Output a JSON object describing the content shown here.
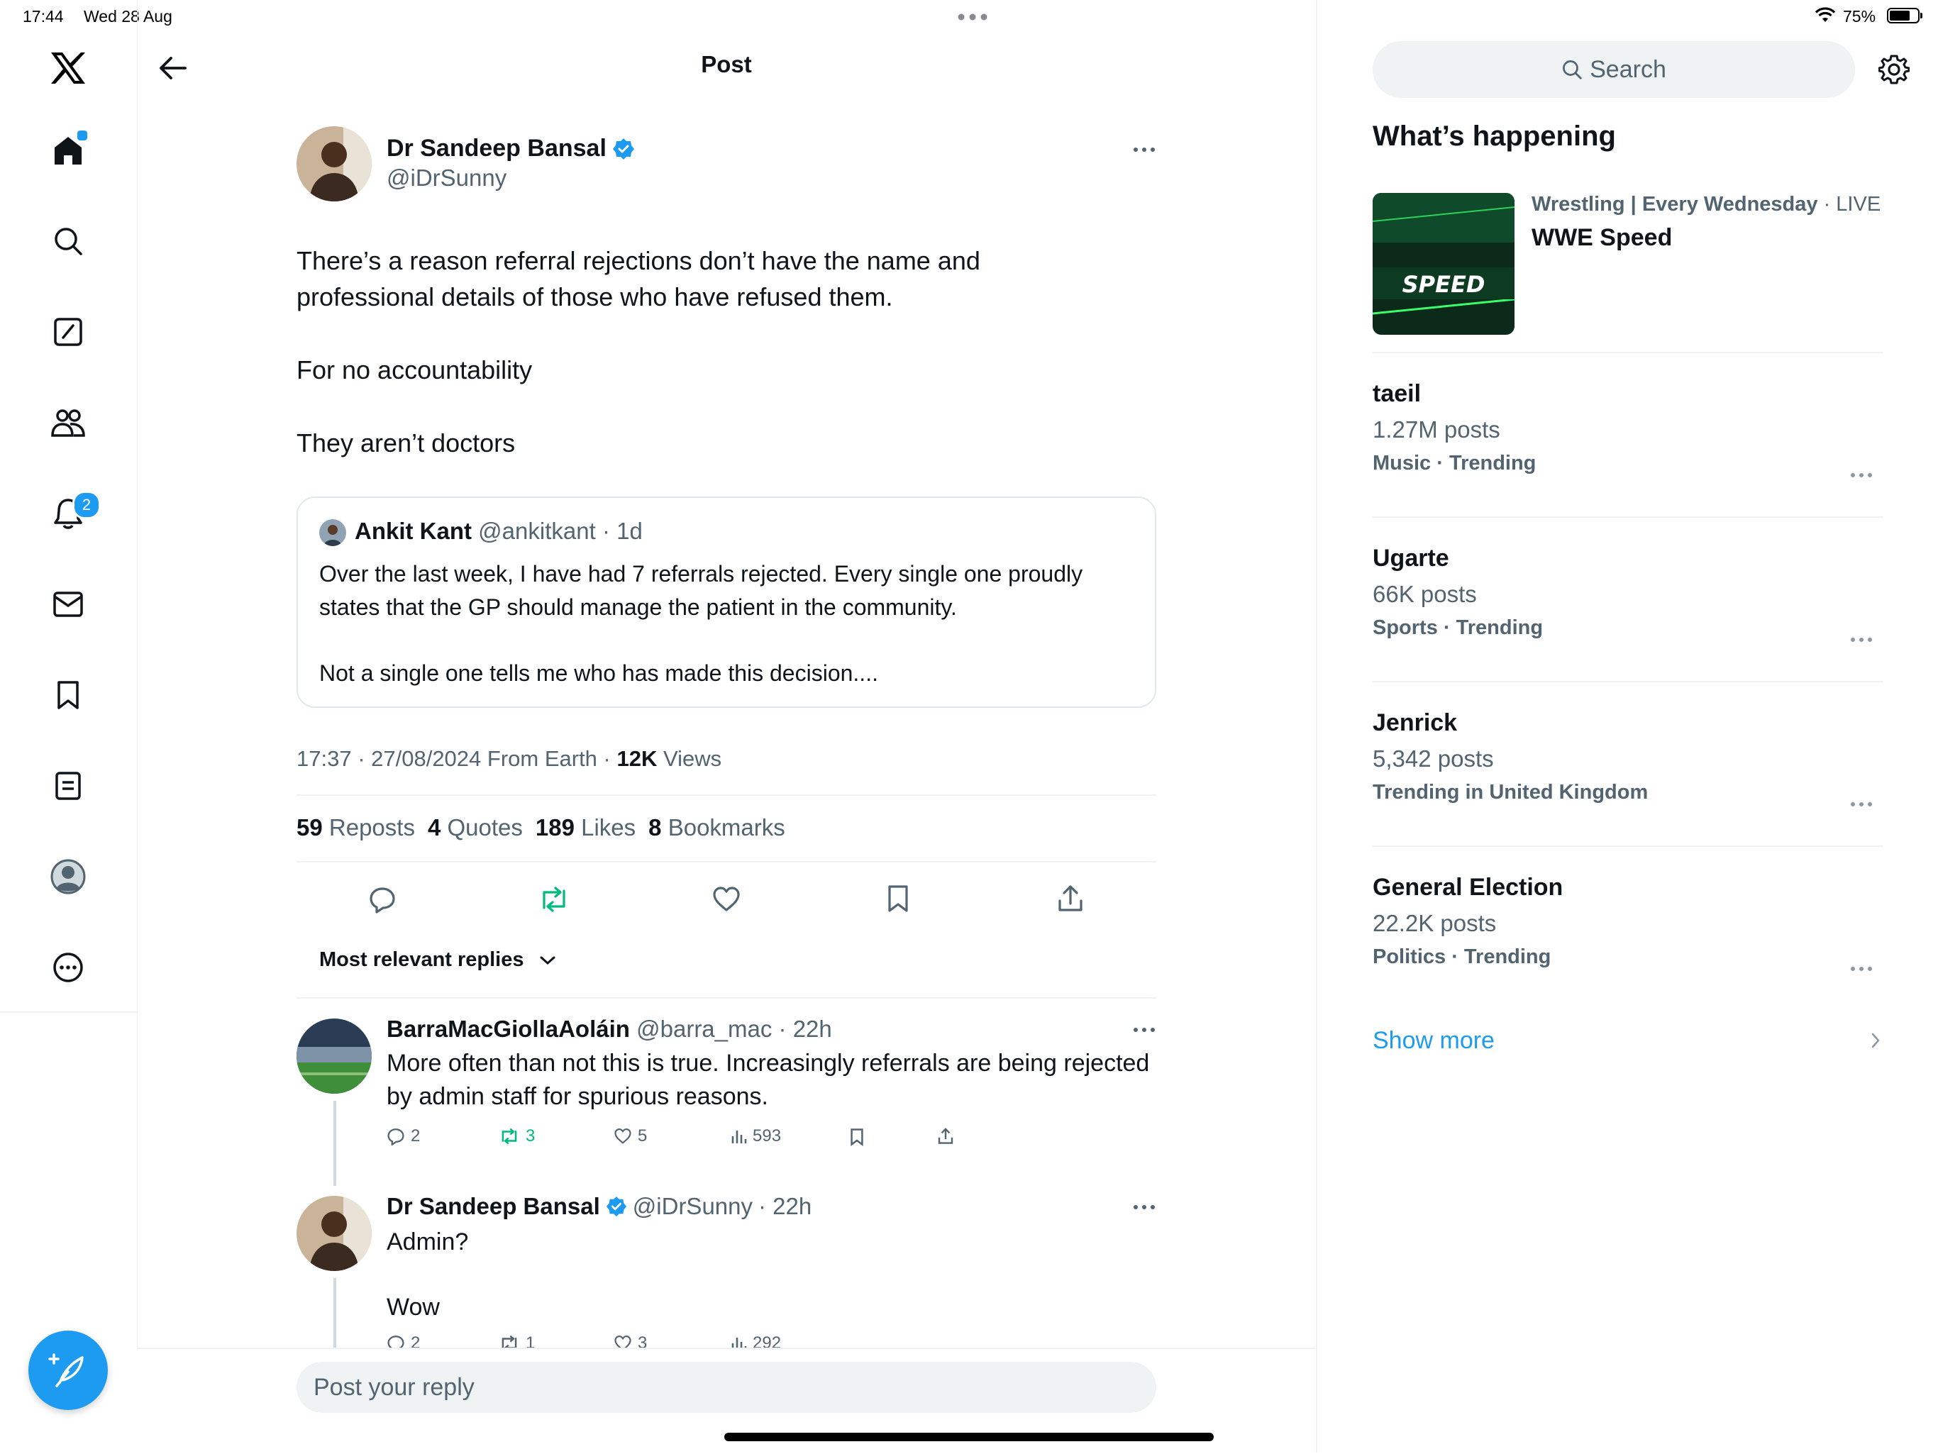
{
  "status_bar": {
    "time": "17:44",
    "date": "Wed 28 Aug",
    "battery": "75%"
  },
  "nav": {
    "notifications_badge": "2"
  },
  "header": {
    "title": "Post"
  },
  "post": {
    "author_name": "Dr Sandeep Bansal",
    "author_handle": "@iDrSunny",
    "paragraphs": [
      "There’s a reason referral rejections don’t have the name and professional details of those who have refused them.",
      "For no accountability",
      "They aren’t doctors"
    ],
    "quoted": {
      "author_name": "Ankit Kant",
      "author_handle": "@ankitkant",
      "time": "· 1d",
      "text1": "Over the last week, I have had 7 referrals rejected. Every single one proudly states that the GP should manage the patient in the community.",
      "text2": "Not a single one tells me who has made this decision...."
    },
    "meta": {
      "datetime": "17:37 · 27/08/2024 From Earth · ",
      "views_count": "12K",
      "views_label": " Views"
    },
    "stats": [
      {
        "count": "59",
        "label": "Reposts"
      },
      {
        "count": "4",
        "label": "Quotes"
      },
      {
        "count": "189",
        "label": "Likes"
      },
      {
        "count": "8",
        "label": "Bookmarks"
      }
    ],
    "sort_label": "Most relevant replies"
  },
  "replies": [
    {
      "author_name": "BarraMacGiollaAoláin",
      "author_handle": "@barra_mac",
      "time": "· 22h",
      "text": "More often than not this is true. Increasingly referrals are being rejected by admin staff for spurious reasons.",
      "replies": "2",
      "reposts": "3",
      "likes": "5",
      "views": "593"
    },
    {
      "author_name": "Dr Sandeep Bansal",
      "author_handle": "@iDrSunny",
      "time": "· 22h",
      "text1": "Admin?",
      "text2": "Wow",
      "replies": "2",
      "reposts": "1",
      "likes": "3",
      "views": "292"
    }
  ],
  "reply_box": {
    "placeholder": "Post your reply"
  },
  "sidebar": {
    "search_placeholder": "Search",
    "heading": "What’s happening",
    "event": {
      "category": "Wrestling | Every Wednesday",
      "live": " · LIVE",
      "title": "WWE Speed",
      "image_text": "SPEED"
    },
    "trends": [
      {
        "title": "taeil",
        "posts": "1.27M posts",
        "context": "Music · Trending"
      },
      {
        "title": "Ugarte",
        "posts": "66K posts",
        "context": "Sports · Trending"
      },
      {
        "title": "Jenrick",
        "posts": "5,342 posts",
        "context": "Trending in United Kingdom"
      },
      {
        "title": "General Election",
        "posts": "22.2K posts",
        "context": "Politics · Trending"
      }
    ],
    "show_more": "Show more"
  },
  "colors": {
    "accent": "#1d9bf0",
    "repost_green": "#00ba7c",
    "muted": "#536471"
  }
}
